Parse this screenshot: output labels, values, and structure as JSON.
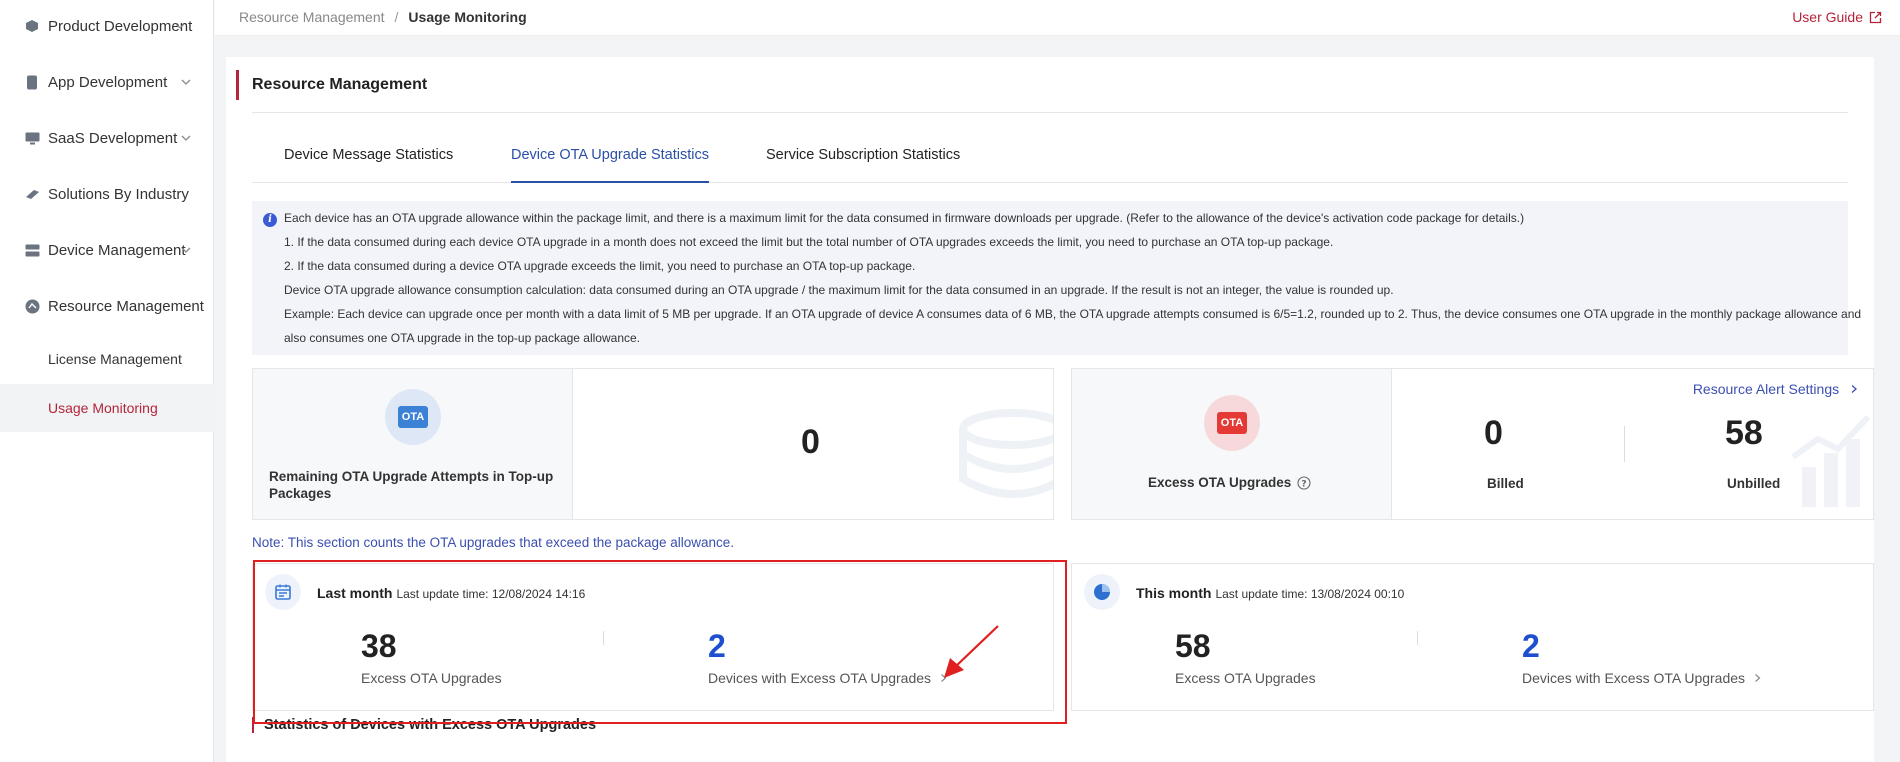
{
  "sidebar": {
    "items": [
      {
        "label": "Product Development",
        "icon": "cube-icon",
        "expandable": true
      },
      {
        "label": "App Development",
        "icon": "phone-icon",
        "expandable": true
      },
      {
        "label": "SaaS Development",
        "icon": "monitor-icon",
        "expandable": true
      },
      {
        "label": "Solutions By Industry",
        "icon": "layers-icon",
        "expandable": false
      },
      {
        "label": "Device Management",
        "icon": "server-icon",
        "expandable": true
      },
      {
        "label": "Resource Management",
        "icon": "gauge-icon",
        "expandable": false
      }
    ],
    "sub_items": [
      {
        "label": "License Management",
        "active": false
      },
      {
        "label": "Usage Monitoring",
        "active": true
      }
    ],
    "active_color": "#b5243a"
  },
  "header": {
    "breadcrumb": [
      "Resource Management",
      "Usage Monitoring"
    ],
    "breadcrumb_separator": "/",
    "user_guide": "User Guide"
  },
  "main": {
    "title": "Resource Management",
    "tabs": [
      {
        "label": "Device Message Statistics",
        "active": false
      },
      {
        "label": "Device OTA Upgrade Statistics",
        "active": true
      },
      {
        "label": "Service Subscription Statistics",
        "active": false
      }
    ],
    "notice": [
      "Each device has an OTA upgrade allowance within the package limit, and there is a maximum limit for the data consumed in firmware downloads per upgrade. (Refer to the allowance of the device's activation code package for details.)",
      "1. If the data consumed during each device OTA upgrade in a month does not exceed the limit but the total number of OTA upgrades exceeds the limit, you need to purchase an OTA top-up package.",
      "2. If the data consumed during a device OTA upgrade exceeds the limit, you need to purchase an OTA top-up package.",
      "Device OTA upgrade allowance consumption calculation: data consumed during an OTA upgrade / the maximum limit for the data consumed in an upgrade. If the result is not an integer, the value is rounded up.",
      "Example: Each device can upgrade once per month with a data limit of 5 MB per upgrade. If an OTA upgrade of device A consumes data of 6 MB, the OTA upgrade attempts consumed is 6/5=1.2, rounded up to 2. Thus, the device consumes one OTA upgrade in the monthly package allowance and",
      "also consumes one OTA upgrade in the top-up package allowance."
    ],
    "remaining_card": {
      "badge": "OTA",
      "label": "Remaining OTA Upgrade Attempts in Top-up Packages",
      "value": "0"
    },
    "excess_card": {
      "badge": "OTA",
      "label": "Excess OTA Upgrades",
      "alert_link": "Resource Alert Settings",
      "billed_value": "0",
      "billed_label": "Billed",
      "unbilled_value": "58",
      "unbilled_label": "Unbilled"
    },
    "note": "Note: This section counts the OTA upgrades that exceed the package allowance.",
    "last_month": {
      "title": "Last month",
      "update": "Last update time: 12/08/2024 14:16",
      "excess_value": "38",
      "excess_label": "Excess OTA Upgrades",
      "devices_value": "2",
      "devices_label": "Devices with Excess OTA Upgrades"
    },
    "this_month": {
      "title": "This month",
      "update": "Last update time: 13/08/2024 00:10",
      "excess_value": "58",
      "excess_label": "Excess OTA Upgrades",
      "devices_value": "2",
      "devices_label": "Devices with Excess OTA Upgrades"
    },
    "bottom_title": "Statistics of Devices with Excess OTA Upgrades",
    "colors": {
      "link": "#3b4fb0",
      "accent_blue": "#1f4fd1",
      "highlight": "#e02020"
    }
  }
}
